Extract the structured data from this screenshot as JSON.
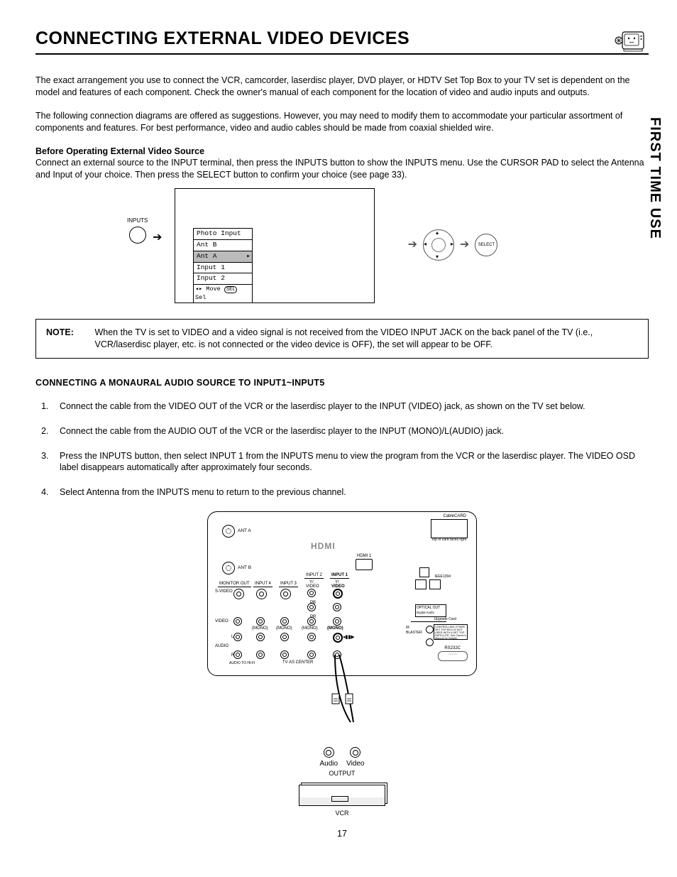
{
  "header": {
    "title": "CONNECTING EXTERNAL VIDEO DEVICES",
    "side_tab": "FIRST TIME USE",
    "page_number": "17"
  },
  "intro": {
    "p1": "The exact arrangement you use to connect the VCR, camcorder, laserdisc player, DVD player, or HDTV Set Top Box to your TV set is dependent on the model and features of each component.  Check the owner's manual of each component for the location of video and audio inputs and outputs.",
    "p2": "The following connection diagrams are offered as suggestions.  However, you may need to modify them to accommodate your particular assortment of components and features.  For best performance, video and audio cables should be made from coaxial shielded wire."
  },
  "before": {
    "heading": "Before Operating External Video Source",
    "text": "Connect an external source to the INPUT terminal, then press the INPUTS button to show the INPUTS menu.  Use the CURSOR PAD to select the Antenna and Input of your choice.  Then press the SELECT button to confirm your choice (see page 33)."
  },
  "menu": {
    "button_label": "INPUTS",
    "items": [
      "Photo Input",
      "Ant B",
      "Ant A",
      "Input 1",
      "Input 2"
    ],
    "selected_index": 2,
    "hint_move": "Move",
    "hint_sel": "Sel"
  },
  "remote": {
    "select_label": "SELECT"
  },
  "note": {
    "label": "NOTE:",
    "text": "When the TV is set to VIDEO and a video signal is not received from the VIDEO INPUT JACK on the back panel of the TV (i.e., VCR/laserdisc player, etc. is not connected or the video device is OFF), the set will appear to be OFF."
  },
  "monaural": {
    "heading": "CONNECTING A MONAURAL AUDIO SOURCE TO INPUT1~INPUT5",
    "steps": [
      "Connect the cable from the VIDEO OUT of the VCR or the laserdisc player to the INPUT (VIDEO) jack, as shown on the TV set below.",
      "Connect the cable from the AUDIO OUT of the VCR or the laserdisc player to the INPUT (MONO)/L(AUDIO) jack.",
      "Press the INPUTS button, then select INPUT 1 from the INPUTS menu to view the program from the VCR or the laserdisc player.  The VIDEO OSD label disappears automatically after approximately four seconds.",
      "Select Antenna from the INPUTS menu to return to the previous channel."
    ]
  },
  "panel": {
    "ant_a": "ANT A",
    "ant_b": "ANT B",
    "hdmi": "HDMI",
    "hdmi1": "HDMI 1",
    "monitor_out": "MONITOR OUT",
    "input1": "INPUT 1",
    "input2": "INPUT 2",
    "input3": "INPUT 3",
    "input4": "INPUT 4",
    "svideo": "S-VIDEO",
    "video": "VIDEO",
    "video_b": "VIDEO",
    "mono": "(MONO)",
    "audio": "AUDIO",
    "tv_center": "TV AS CENTER",
    "audio_to_av": "AUDIO TO HI-FI",
    "pb": "PB",
    "pr": "PR",
    "cablecard": "CableCARD",
    "cablecard_sub": "Top of card faces right",
    "ieee1394": "IEEE1394",
    "optical": "OPTICAL OUT",
    "optical_sub": "Digital Audio",
    "upgrade": "Upgrade Card",
    "ir_blaster": "IR BLASTER",
    "ir_text": "CONTROLLING OTHER SET TOP BOX IS NOT USED WITH A SET TOP SATELLITE. See Owner's Manual for Details.",
    "rs232": "RS232C",
    "r": "R",
    "l": "L"
  },
  "output": {
    "audio": "Audio",
    "video": "Video",
    "label": "OUTPUT",
    "vcr": "VCR"
  }
}
